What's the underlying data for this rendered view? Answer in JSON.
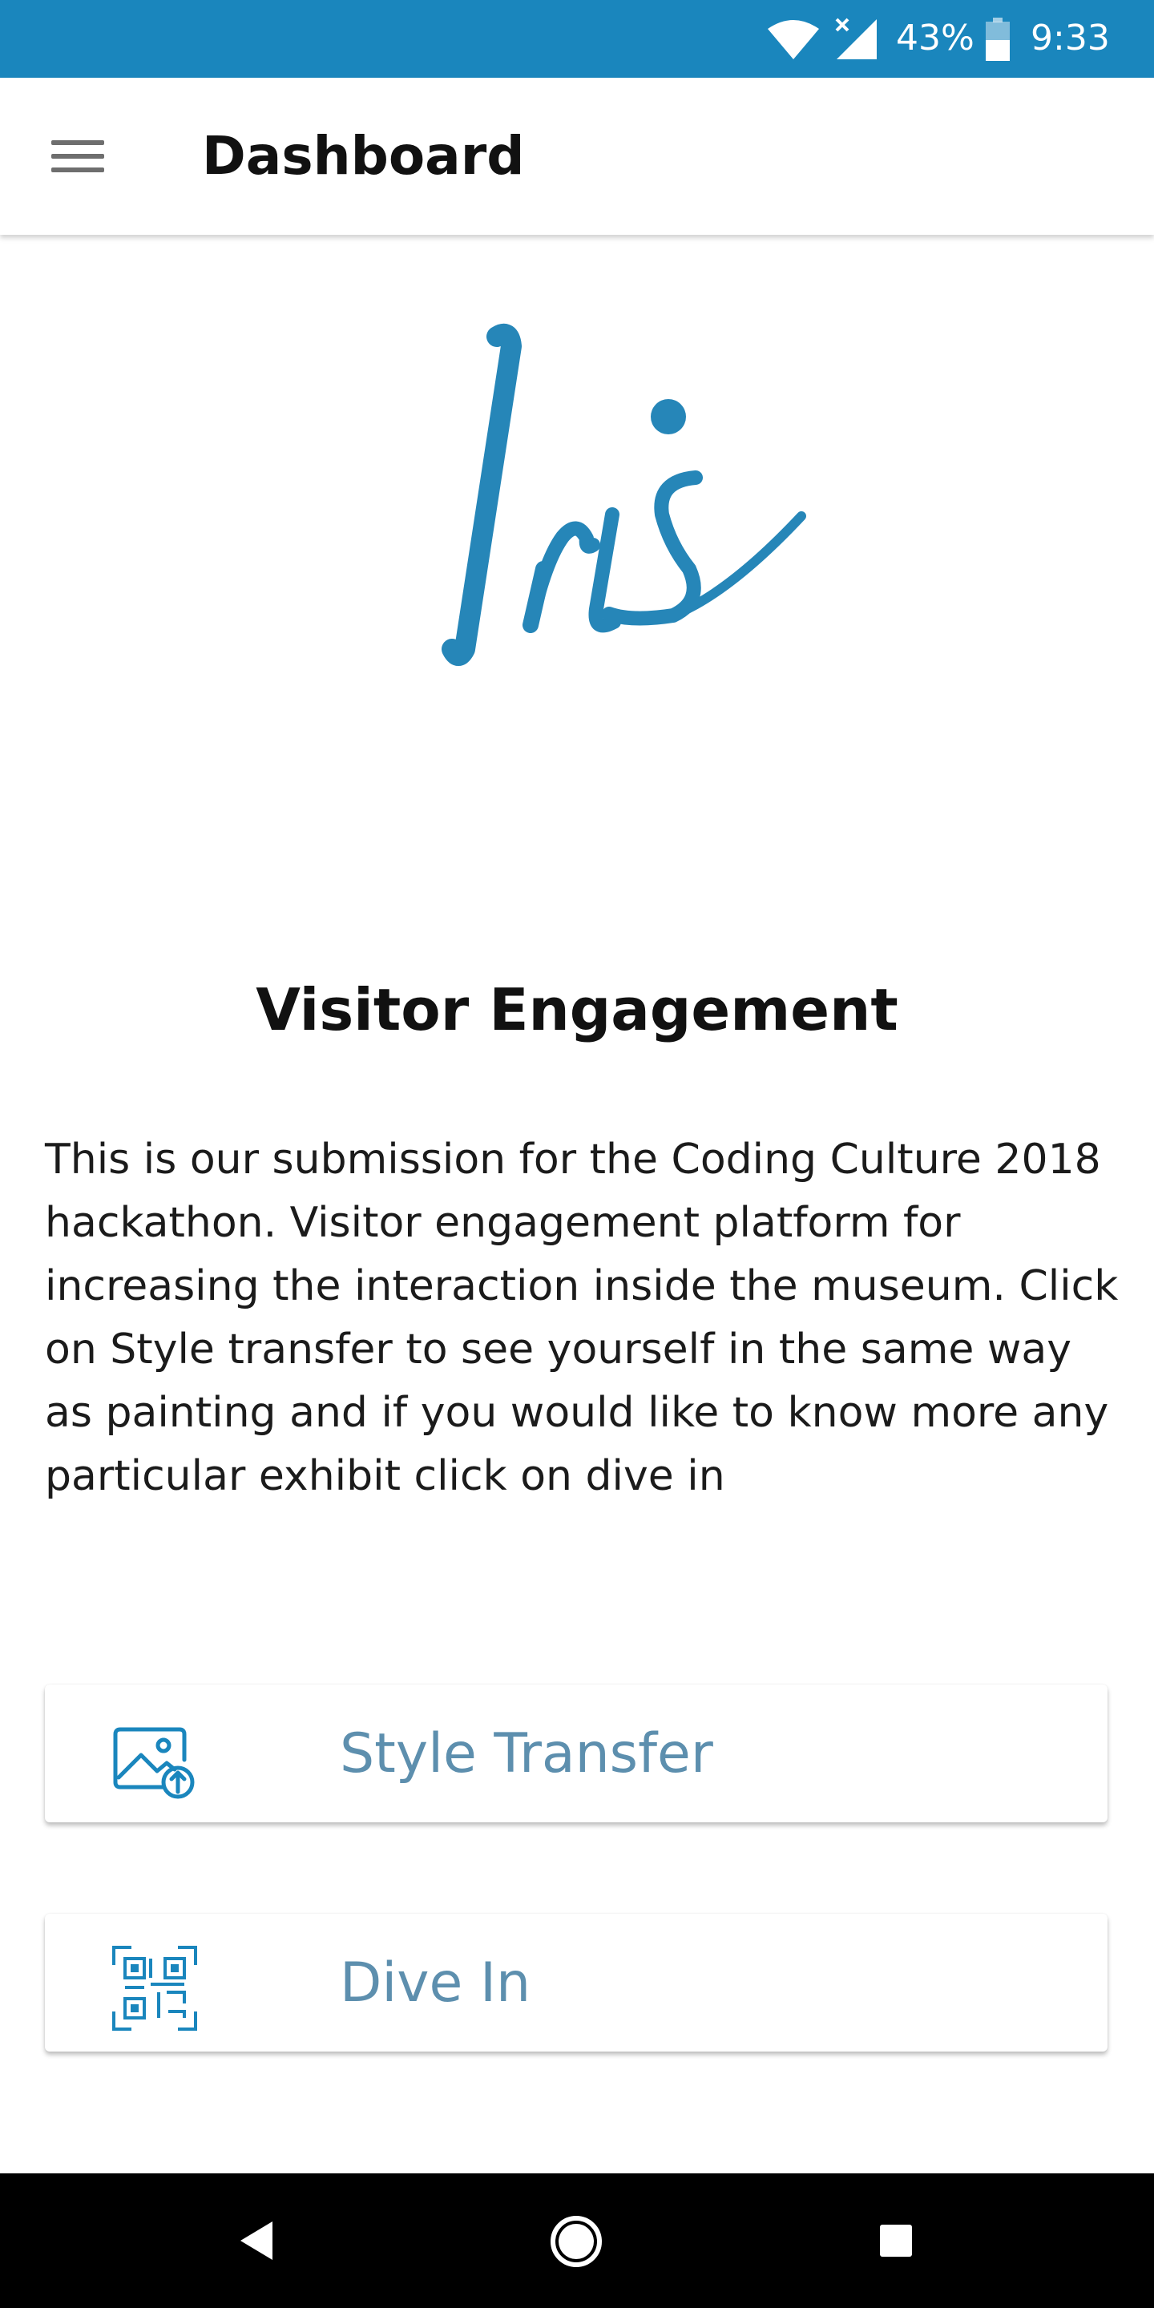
{
  "status_bar": {
    "battery_percent": "43%",
    "time": "9:33",
    "icons": [
      "wifi-icon",
      "cell-signal-icon",
      "battery-icon"
    ],
    "background_color": "#1a86bd"
  },
  "app_bar": {
    "menu_icon": "hamburger-menu-icon",
    "title": "Dashboard"
  },
  "logo": {
    "text": "Iris",
    "color": "#2686b8"
  },
  "main": {
    "heading": "Visitor Engagement",
    "description": "This is our submission for the Coding Culture 2018 hackathon. Visitor engagement platform for increasing the interaction inside the museum. Click on Style transfer to see yourself in the same way as painting and if you would like to know more any particular exhibit click on dive in"
  },
  "actions": [
    {
      "label": "Style Transfer",
      "icon": "image-upload-icon"
    },
    {
      "label": "Dive In",
      "icon": "qr-code-scan-icon"
    }
  ],
  "accent_color": "#1a86bd",
  "button_text_color": "#5d8fae",
  "nav_bar": {
    "icons": [
      "back-icon",
      "home-icon",
      "recents-icon"
    ]
  }
}
